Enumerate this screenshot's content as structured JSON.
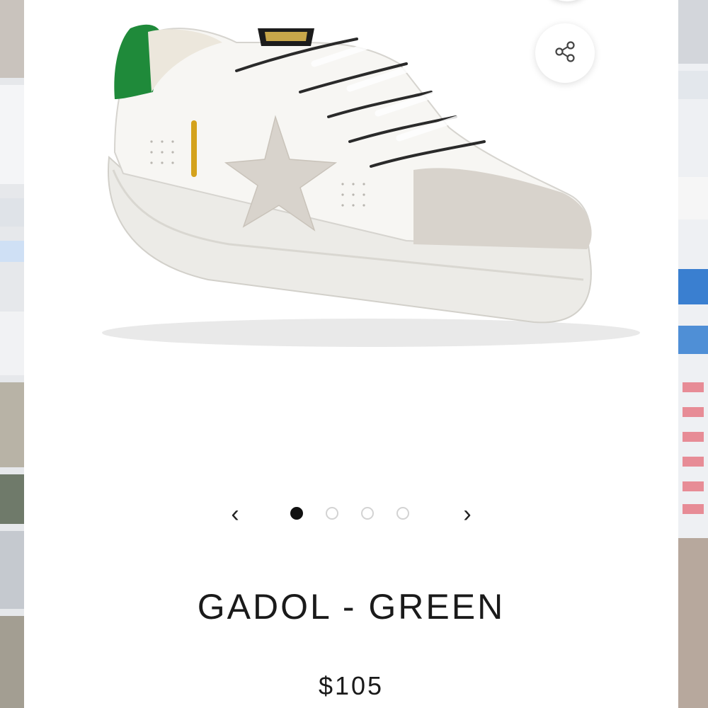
{
  "product": {
    "title": "GADOL - GREEN",
    "price": "$105",
    "image": {
      "subject": "sneaker",
      "colors": {
        "upper": "#f7f6f3",
        "suede": "#d8d3cc",
        "heel_tab": "#1f8a3a",
        "gold_accent": "#d4a21c",
        "sole": "#ecebe7"
      }
    }
  },
  "share": {
    "icon": "share-icon"
  },
  "carousel": {
    "prev_icon": "chevron-left-icon",
    "next_icon": "chevron-right-icon",
    "prev_glyph": "‹",
    "next_glyph": "›",
    "total": 4,
    "active_index": 0
  }
}
